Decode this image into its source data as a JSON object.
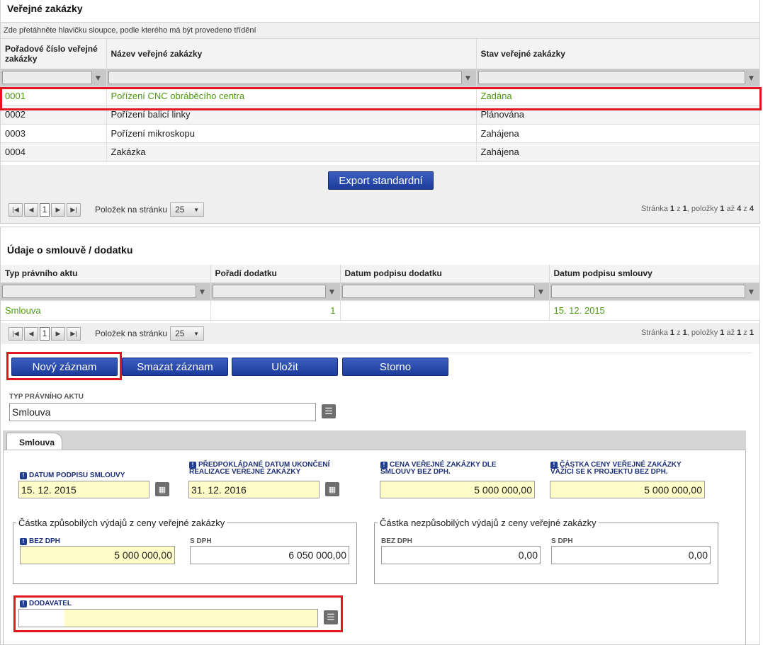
{
  "section1": {
    "title": "Veřejné zakázky",
    "hint": "Zde přetáhněte hlavičku sloupce, podle kterého má být provedeno třídění",
    "columns": [
      "Pořadové číslo veřejné zakázky",
      "Název veřejné zakázky",
      "Stav veřejné zakázky"
    ],
    "rows": [
      [
        "0001",
        "Pořízení CNC obráběcího centra",
        "Zadána"
      ],
      [
        "0002",
        "Pořízení balicí linky",
        "Plánována"
      ],
      [
        "0003",
        "Pořízení mikroskopu",
        "Zahájena"
      ],
      [
        "0004",
        "Zakázka",
        "Zahájena"
      ]
    ],
    "export_label": "Export standardní",
    "pager": {
      "page": "1",
      "per_page_label": "Položek na stránku",
      "per_page": "25",
      "info_prefix": "Stránka ",
      "info_page": "1",
      "info_of": " z ",
      "info_pages": "1",
      "info_items": ", položky ",
      "info_from": "1",
      "info_to_word": " až ",
      "info_to": "4",
      "info_z2": " z ",
      "info_total": "4"
    }
  },
  "section2": {
    "title": "Údaje o smlouvě / dodatku",
    "columns": [
      "Typ právního aktu",
      "Pořadí dodatku",
      "Datum podpisu dodatku",
      "Datum podpisu smlouvy"
    ],
    "rows": [
      [
        "Smlouva",
        "1",
        "",
        "15. 12. 2015"
      ]
    ],
    "pager": {
      "page": "1",
      "per_page_label": "Položek na stránku",
      "per_page": "25",
      "info_prefix": "Stránka ",
      "info_page": "1",
      "info_of": " z ",
      "info_pages": "1",
      "info_items": ", položky ",
      "info_from": "1",
      "info_to_word": " až ",
      "info_to": "1",
      "info_z2": " z ",
      "info_total": "1"
    }
  },
  "actions": {
    "new": "Nový záznam",
    "delete": "Smazat záznam",
    "save": "Uložit",
    "cancel": "Storno"
  },
  "form": {
    "typ_label": "TYP PRÁVNÍHO AKTU",
    "typ_value": "Smlouva",
    "tab": "Smlouva",
    "datum_podpisu_label": "DATUM PODPISU SMLOUVY",
    "datum_podpisu_value": "15. 12. 2015",
    "datum_ukonceni_label": "PŘEDPOKLÁDANÉ DATUM UKONČENÍ REALIZACE VEŘEJNÉ ZAKÁZKY",
    "datum_ukonceni_value": "31. 12. 2016",
    "cena_label": "CENA VEŘEJNÉ ZAKÁZKY DLE SMLOUVY BEZ DPH.",
    "cena_value": "5 000 000,00",
    "castka_label": "ČÁSTKA CENY VEŘEJNÉ ZAKÁZKY VÁŽÍCÍ SE K PROJEKTU BEZ DPH.",
    "castka_value": "5 000 000,00",
    "zpusobile_legend": "Částka způsobilých výdajů z ceny veřejné zakázky",
    "zpus_bez_label": "BEZ DPH",
    "zpus_bez_value": "5 000 000,00",
    "zpus_s_label": "S DPH",
    "zpus_s_value": "6 050 000,00",
    "nezpusobile_legend": "Částka nezpůsobilých výdajů z ceny veřejné zakázky",
    "nez_bez_label": "BEZ DPH",
    "nez_bez_value": "0,00",
    "nez_s_label": "S DPH",
    "nez_s_value": "0,00",
    "dodavatel_label": "DODAVATEL",
    "dodavatel_value": ""
  },
  "colors": {
    "selected_text": "#4c9a0e",
    "highlight": "#e3151e",
    "button": "#1c3b9b",
    "required_bg": "#fffcc8"
  },
  "icons": [
    "filter-icon",
    "first-page-icon",
    "prev-page-icon",
    "next-page-icon",
    "last-page-icon",
    "calendar-icon",
    "list-icon",
    "required-icon",
    "dropdown-arrow-icon"
  ]
}
